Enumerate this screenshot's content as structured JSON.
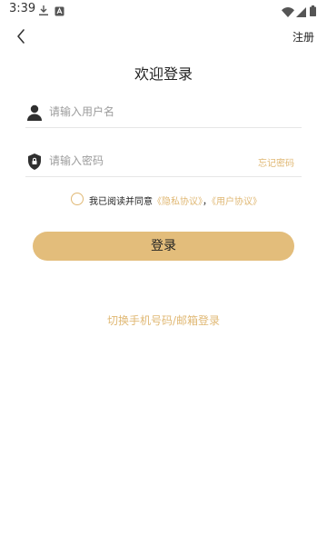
{
  "status_bar": {
    "time": "3:39",
    "icons": [
      "download-icon",
      "app-notification-icon",
      "wifi-icon",
      "cellular-signal-icon",
      "battery-icon"
    ]
  },
  "nav": {
    "back_icon": "chevron-left-icon",
    "register_label": "注册"
  },
  "title": "欢迎登录",
  "form": {
    "username": {
      "icon": "user-icon",
      "placeholder": "请输入用户名",
      "value": ""
    },
    "password": {
      "icon": "shield-lock-icon",
      "placeholder": "请输入密码",
      "value": "",
      "forgot_label": "忘记密码"
    }
  },
  "agreement": {
    "checked": false,
    "prefix": "我已阅读并同意",
    "privacy_link": "《隐私协议》",
    "separator": "，",
    "user_link": "《用户协议》"
  },
  "login_button": "登录",
  "switch_mode_link": "切换手机号码/邮箱登录",
  "colors": {
    "accent": "#e0b874",
    "button_bg": "#e3bd7b",
    "divider": "#e6e6e6"
  }
}
